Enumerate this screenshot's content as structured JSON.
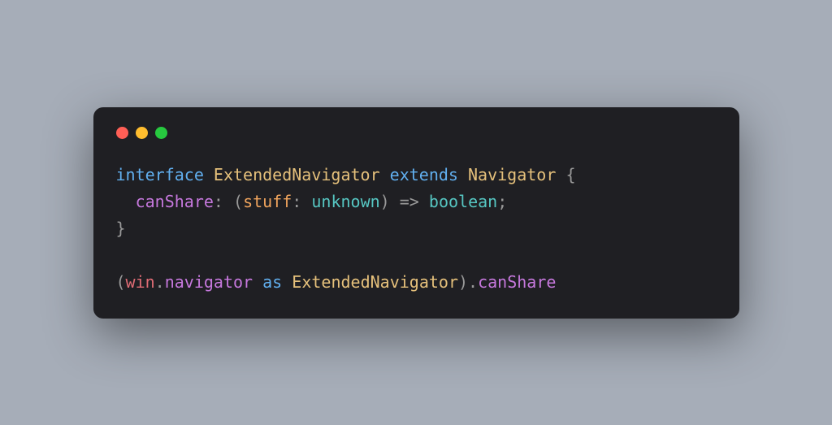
{
  "window": {
    "traffic_lights": {
      "red": "#ff5f56",
      "yellow": "#ffbd2e",
      "green": "#27c93f"
    }
  },
  "code": {
    "line1": {
      "kw_interface": "interface",
      "space1": " ",
      "typename_ext": "ExtendedNavigator",
      "space2": " ",
      "kw_extends": "extends",
      "space3": " ",
      "typename_nav": "Navigator",
      "space4": " ",
      "brace_open": "{"
    },
    "line2": {
      "indent": "  ",
      "prop_canshare": "canShare",
      "colon1": ":",
      "space1": " ",
      "paren_open": "(",
      "param_stuff": "stuff",
      "colon2": ":",
      "space2": " ",
      "type_unknown": "unknown",
      "paren_close": ")",
      "space3": " ",
      "arrow": "=>",
      "space4": " ",
      "type_boolean": "boolean",
      "semi": ";"
    },
    "line3": {
      "brace_close": "}"
    },
    "blank": "",
    "line5": {
      "paren_open": "(",
      "var_win": "win",
      "dot1": ".",
      "prop_navigator": "navigator",
      "space1": " ",
      "kw_as": "as",
      "space2": " ",
      "typename_ext": "ExtendedNavigator",
      "paren_close": ")",
      "dot2": ".",
      "prop_canshare": "canShare"
    }
  }
}
